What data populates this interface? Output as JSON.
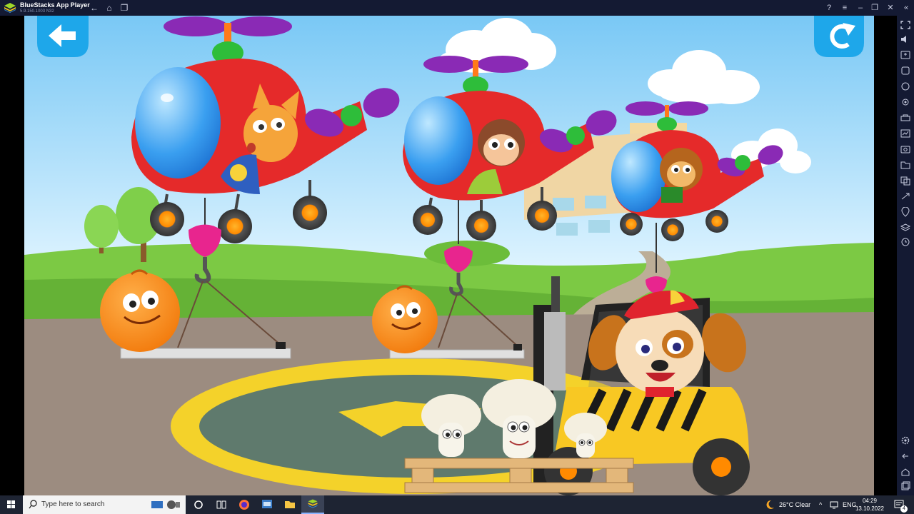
{
  "window": {
    "title": "BlueStacks App Player",
    "subtitle": "5.9.150.1003 N32"
  },
  "game": {
    "back_icon": "arrow-left-icon",
    "restart_icon": "restart-icon"
  },
  "taskbar": {
    "search_placeholder": "Type here to search",
    "weather": "26°C  Clear",
    "language": "ENG",
    "time": "04:29",
    "date": "13.10.2022",
    "notification_count": "4"
  },
  "colors": {
    "sky_top": "#79c8f5",
    "sky_bottom": "#d8f1ff",
    "grass": "#7cc944",
    "tarmac": "#9c8c80",
    "helicopter_red": "#e52a2a",
    "propeller_purple": "#8a2ab5",
    "forklift_yellow": "#f8c823"
  }
}
